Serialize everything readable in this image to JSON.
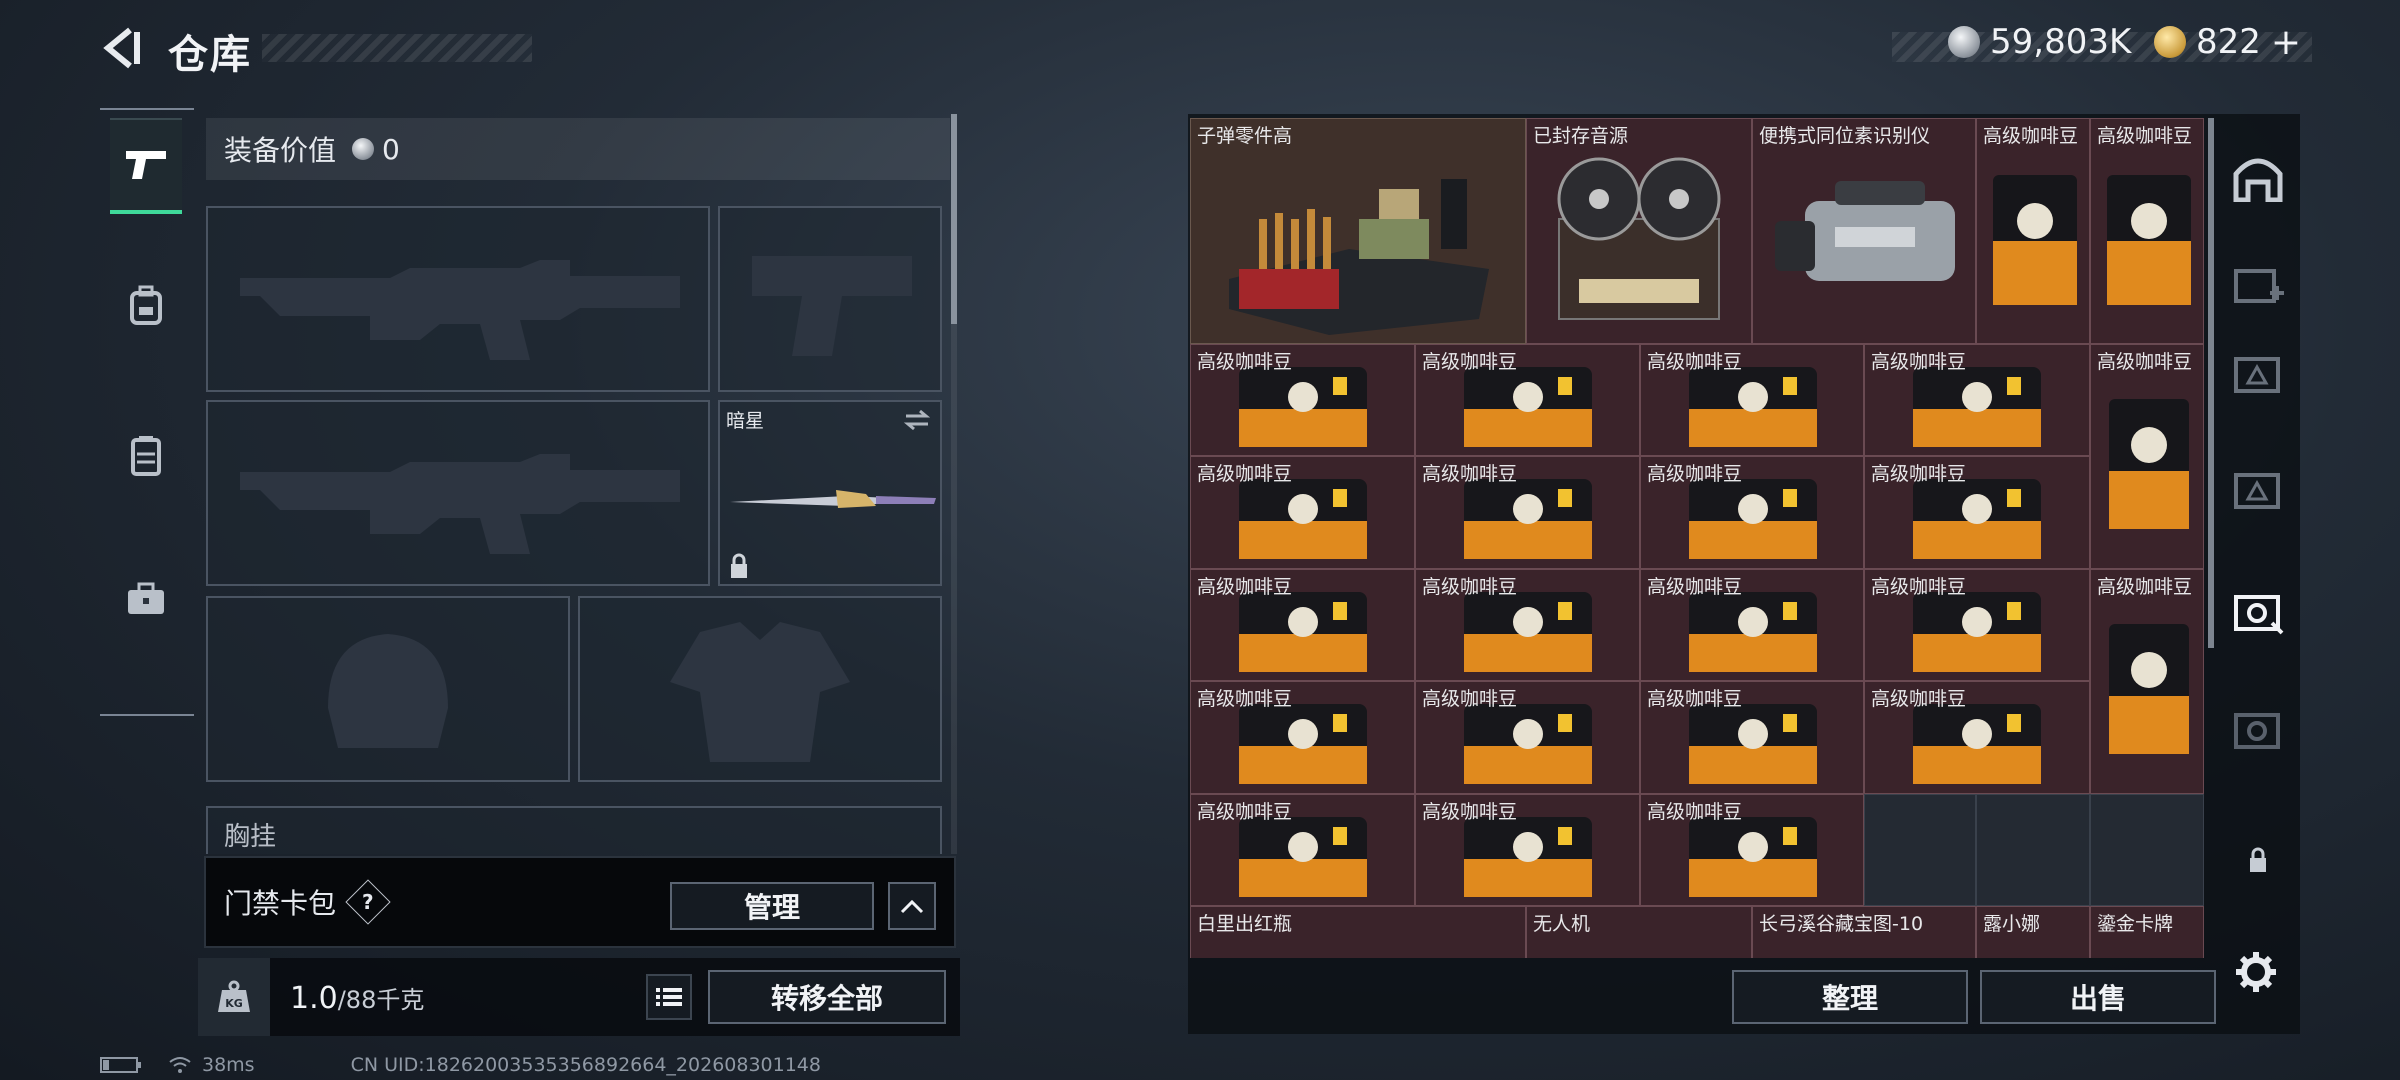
{
  "header": {
    "title": "仓库"
  },
  "currency": {
    "silver": "59,803K",
    "gold": "822",
    "gold_add": "+"
  },
  "equipment": {
    "value_label": "装备价值",
    "value": "0",
    "melee_name": "暗星",
    "chest_label": "胸挂",
    "access_card_label": "门禁卡包",
    "help": "?",
    "manage_button": "管理",
    "weight_current": "1.0",
    "weight_max": "/88千克",
    "kg_label": "KG",
    "transfer_all_button": "转移全部"
  },
  "stash": {
    "row1": [
      "子弹零件高",
      "已封存音源",
      "便携式同位素识别仪",
      "高级咖啡豆",
      "高级咖啡豆"
    ],
    "bean_label": "高级咖啡豆",
    "bottom_row": [
      "白里出红瓶",
      "无人机",
      "长弓溪谷藏宝图-10",
      "露小娜",
      "鎏金卡牌"
    ],
    "sort_button": "整理",
    "sell_button": "出售"
  },
  "status_bar": {
    "ping": "38ms",
    "uid": "CN UID:18262003535356892664_202608301148"
  },
  "colors": {
    "accent_green": "#3fd99a",
    "item_red_bg": "#3a232a"
  }
}
